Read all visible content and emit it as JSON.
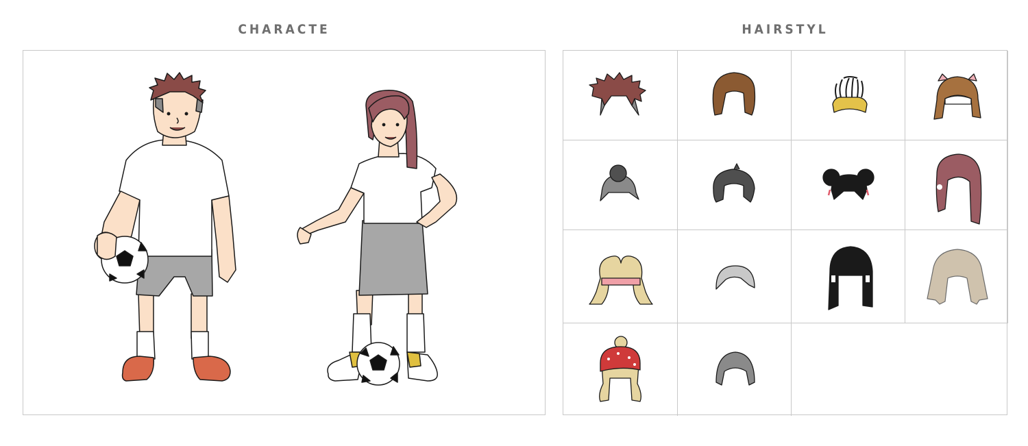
{
  "character_section": {
    "heading": "CHARACTE",
    "characters": [
      {
        "icon": "boy-soccer-player"
      },
      {
        "icon": "girl-soccer-player"
      }
    ]
  },
  "hairstyle_section": {
    "heading": "HAIRSTYL",
    "hairstyles": [
      {
        "icon": "spiky-brown-hair-icon"
      },
      {
        "icon": "brown-bob-hair-icon"
      },
      {
        "icon": "braids-headband-hair-icon"
      },
      {
        "icon": "cat-ears-bangs-hair-icon"
      },
      {
        "icon": "grey-bun-hair-icon"
      },
      {
        "icon": "dark-grey-short-hair-icon"
      },
      {
        "icon": "double-bun-hair-icon"
      },
      {
        "icon": "long-mauve-hair-icon"
      },
      {
        "icon": "blonde-headband-hair-icon"
      },
      {
        "icon": "grey-buzz-hair-icon"
      },
      {
        "icon": "black-long-bangs-hair-icon"
      },
      {
        "icon": "beige-shaggy-hair-icon"
      },
      {
        "icon": "blonde-bandana-hair-icon"
      },
      {
        "icon": "grey-short-hair-icon"
      }
    ]
  },
  "colors": {
    "heading": "#6f6f6f",
    "border": "#c8c8c8",
    "skin": "#fbe0c8",
    "auburn": "#8a4b47",
    "mauve": "#9b5c63",
    "brown": "#8b5a32",
    "grey_shorts": "#a7a7a7",
    "shoe_orange": "#d9694a",
    "blonde": "#e6d5a0"
  }
}
